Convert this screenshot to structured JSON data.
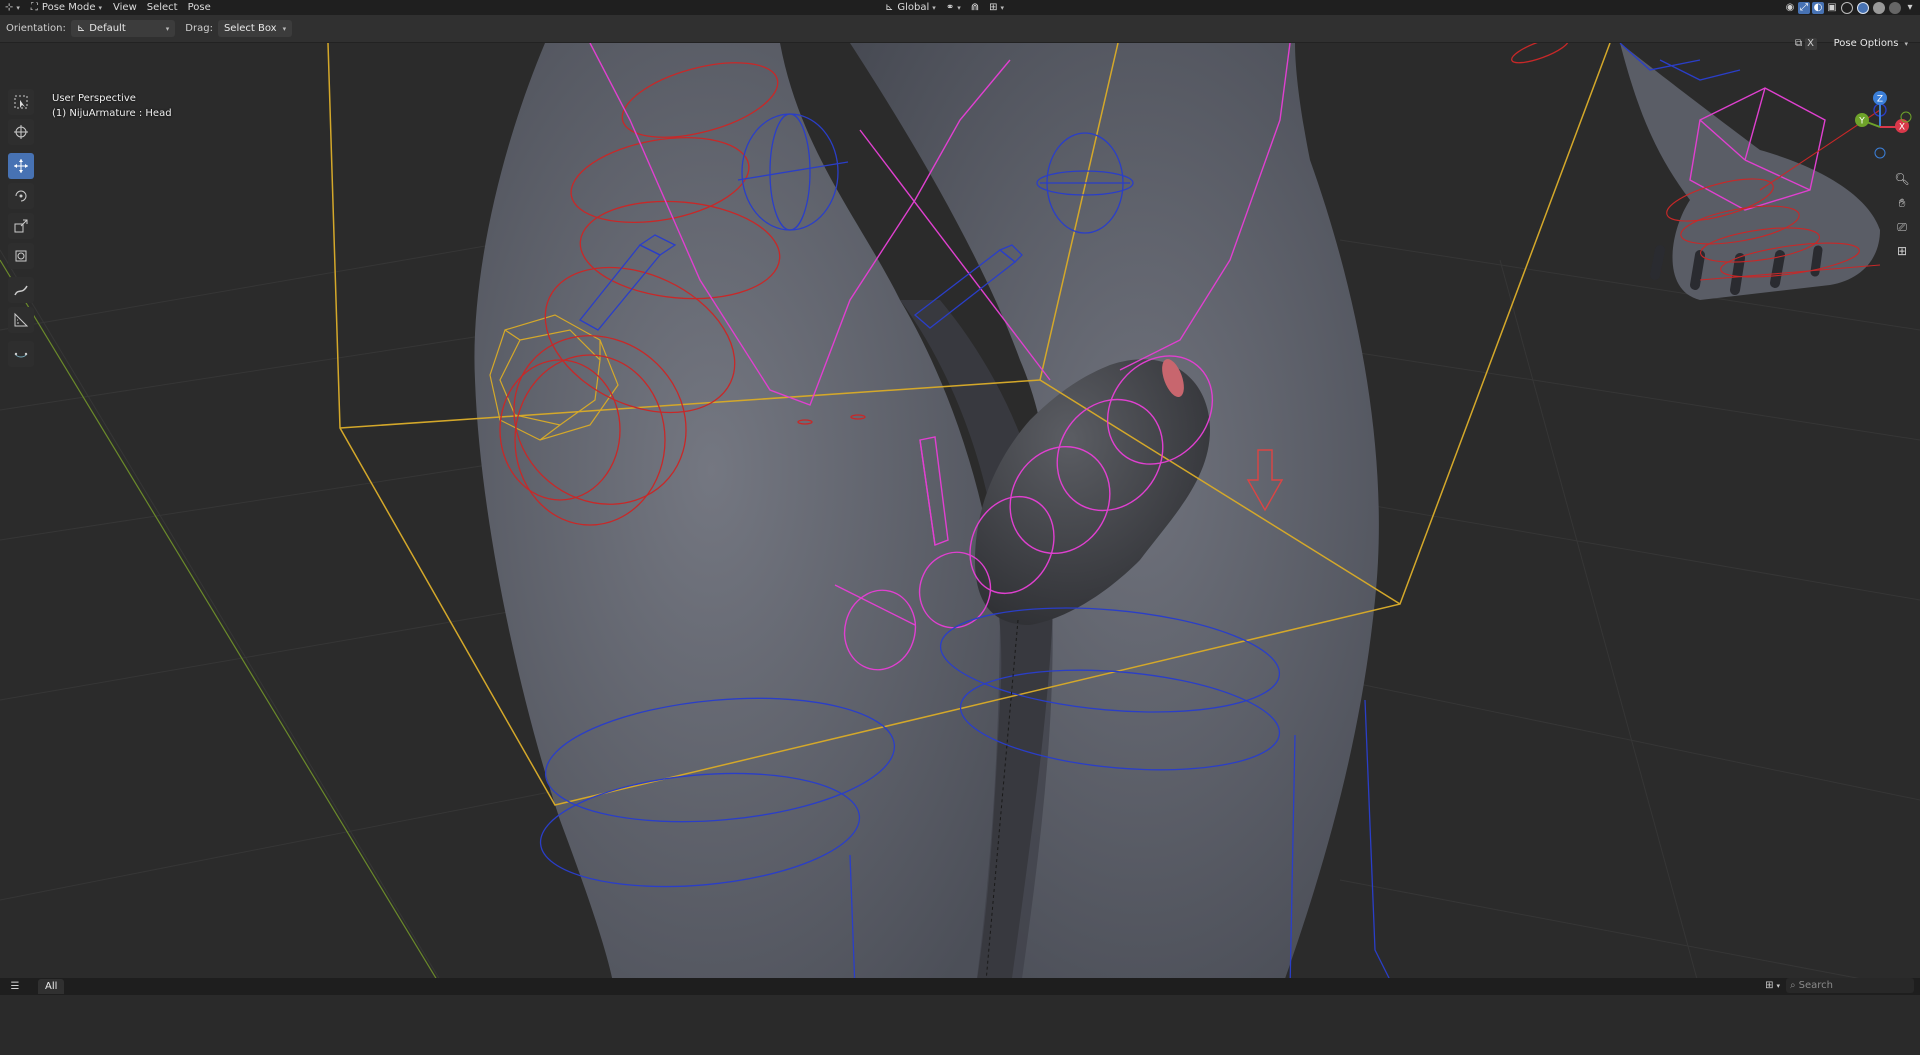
{
  "header": {
    "menus": [
      {
        "label": "View"
      },
      {
        "label": "Select"
      },
      {
        "label": "Pose"
      }
    ],
    "mode": "Pose Mode",
    "transform_orientation": "Global"
  },
  "tool_settings": {
    "orientation_label": "Orientation:",
    "orientation_value": "Default",
    "drag_label": "Drag:",
    "drag_value": "Select Box",
    "pose_options": "Pose Options"
  },
  "viewport": {
    "view_name": "User Perspective",
    "active_object": "(1) NijuArmature : Head",
    "gizmo_axes": {
      "z": "Z",
      "y": "Y",
      "x": "X"
    }
  },
  "toolbar": {
    "tools": [
      "select-box",
      "cursor",
      "move",
      "rotate",
      "scale",
      "transform",
      "annotate",
      "measure",
      "bone-envelope"
    ],
    "active_tool": "move"
  },
  "timeline": {
    "tab": "All",
    "search_placeholder": "Search"
  },
  "colors": {
    "accent": "#4772b3",
    "bone_selected": "#e040d0",
    "bone_red": "#c82828",
    "bone_blue": "#2a3ec8",
    "bbox_yellow": "#d4a82a",
    "grid": "#3a3a3a"
  }
}
